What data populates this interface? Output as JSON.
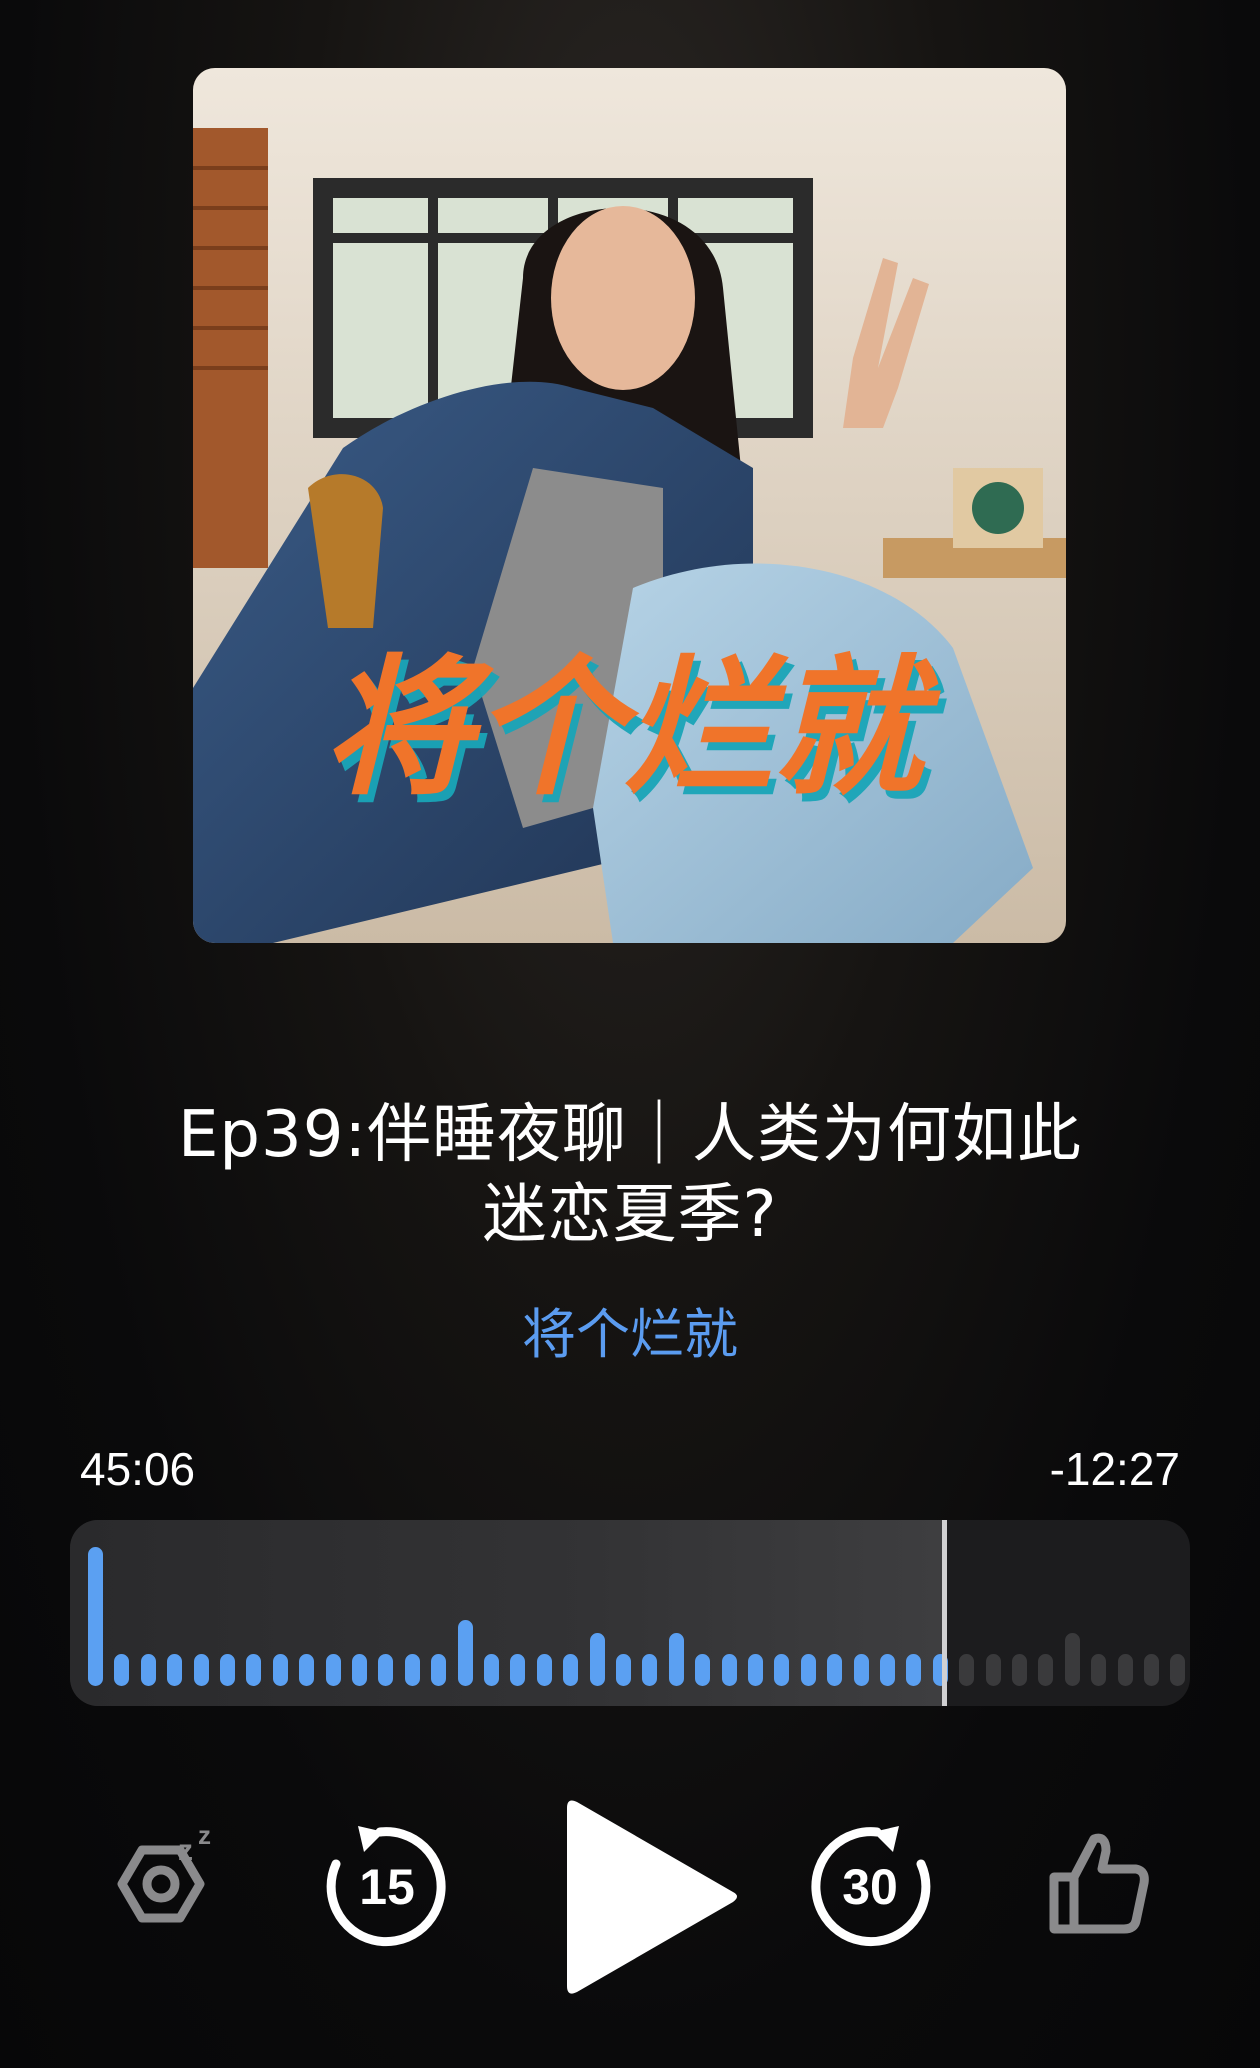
{
  "episode": {
    "title": "Ep39:伴睡夜聊｜人类为何如此迷恋夏季?",
    "show_name": "将个烂就",
    "artwork_text": "将个烂就"
  },
  "progress": {
    "elapsed": "45:06",
    "remaining": "-12:27",
    "fraction_played": 0.78
  },
  "waveform": {
    "heights": [
      0.95,
      0.22,
      0.22,
      0.22,
      0.22,
      0.22,
      0.22,
      0.22,
      0.22,
      0.22,
      0.22,
      0.22,
      0.22,
      0.22,
      0.45,
      0.22,
      0.22,
      0.22,
      0.22,
      0.36,
      0.22,
      0.22,
      0.36,
      0.22,
      0.22,
      0.22,
      0.22,
      0.22,
      0.22,
      0.22,
      0.22,
      0.22,
      0.22,
      0.22,
      0.22,
      0.22,
      0.22,
      0.36,
      0.22,
      0.22,
      0.22,
      0.22,
      0.22
    ],
    "played_color": "#5ba0f2",
    "unplayed_color": "#3a3a3c"
  },
  "controls": {
    "sleep_icon": "sleep-timer-icon",
    "skip_back_label": "15",
    "skip_forward_label": "30",
    "play_icon": "play-icon",
    "like_icon": "thumbs-up-icon"
  }
}
